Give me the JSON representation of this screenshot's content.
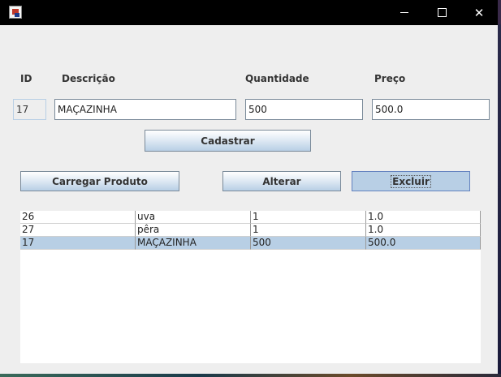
{
  "window": {
    "title": ""
  },
  "labels": {
    "id": "ID",
    "descricao": "Descrição",
    "quantidade": "Quantidade",
    "preco": "Preço"
  },
  "fields": {
    "id": "17",
    "descricao": "MAÇAZINHA",
    "quantidade": "500",
    "preco": "500.0"
  },
  "buttons": {
    "cadastrar": "Cadastrar",
    "carregar": "Carregar Produto",
    "alterar": "Alterar",
    "excluir": "Excluir"
  },
  "table": {
    "rows": [
      [
        "26",
        "uva",
        "1",
        "1.0"
      ],
      [
        "27",
        "pêra",
        "1",
        "1.0"
      ],
      [
        "17",
        "MAÇAZINHA",
        "500",
        "500.0"
      ]
    ],
    "selected_row_index": 2
  },
  "colors": {
    "selection": "#b8cfe5",
    "titlebar": "#000000"
  },
  "icons": [
    "app-icon",
    "minimize-icon",
    "maximize-icon",
    "close-icon"
  ]
}
